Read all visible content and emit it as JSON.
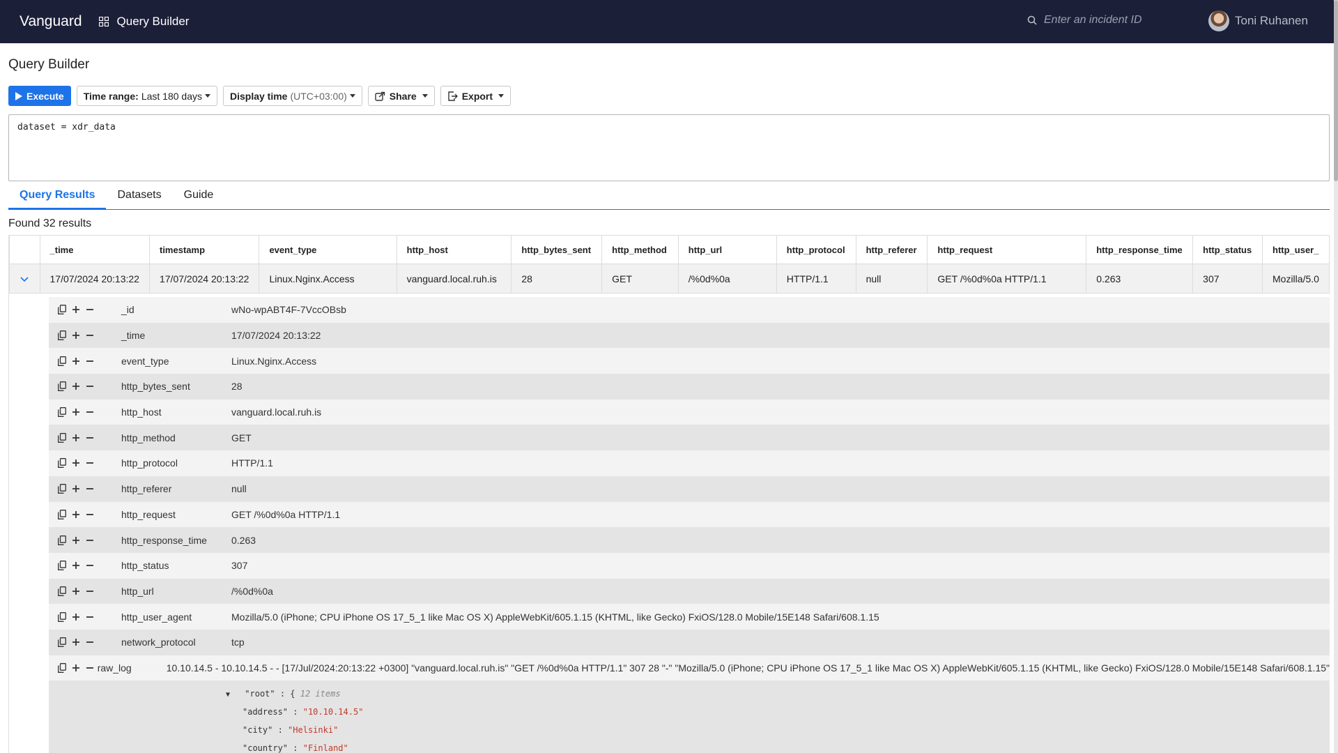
{
  "nav": {
    "brand": "Vanguard",
    "app_label": "Query Builder",
    "search_placeholder": "Enter an incident ID",
    "user_name": "Toni Ruhanen"
  },
  "page": {
    "title": "Query Builder"
  },
  "toolbar": {
    "execute_label": "Execute",
    "time_range_label": "Time range:",
    "time_range_value": "Last 180 days",
    "display_time_label": "Display time",
    "display_time_value": "(UTC+03:00)",
    "share_label": "Share",
    "export_label": "Export"
  },
  "query": {
    "text": "dataset = xdr_data"
  },
  "tabs": [
    {
      "label": "Query Results",
      "active": true
    },
    {
      "label": "Datasets",
      "active": false
    },
    {
      "label": "Guide",
      "active": false
    }
  ],
  "results": {
    "count_text": "Found 32 results",
    "columns": [
      "_time",
      "timestamp",
      "event_type",
      "http_host",
      "http_bytes_sent",
      "http_method",
      "http_url",
      "http_protocol",
      "http_referer",
      "http_request",
      "http_response_time",
      "http_status",
      "http_user_"
    ],
    "row": [
      "17/07/2024 20:13:22",
      "17/07/2024 20:13:22",
      "Linux.Nginx.Access",
      "vanguard.local.ruh.is",
      "28",
      "GET",
      "/%0d%0a",
      "HTTP/1.1",
      "null",
      "GET /%0d%0a HTTP/1.1",
      "0.263",
      "307",
      "Mozilla/5.0"
    ]
  },
  "detail": [
    {
      "name": "_id",
      "value": "wNo-wpABT4F-7VccOBsb"
    },
    {
      "name": "_time",
      "value": "17/07/2024 20:13:22"
    },
    {
      "name": "event_type",
      "value": "Linux.Nginx.Access"
    },
    {
      "name": "http_bytes_sent",
      "value": "28"
    },
    {
      "name": "http_host",
      "value": "vanguard.local.ruh.is"
    },
    {
      "name": "http_method",
      "value": "GET"
    },
    {
      "name": "http_protocol",
      "value": "HTTP/1.1"
    },
    {
      "name": "http_referer",
      "value": "null"
    },
    {
      "name": "http_request",
      "value": "GET /%0d%0a HTTP/1.1"
    },
    {
      "name": "http_response_time",
      "value": "0.263"
    },
    {
      "name": "http_status",
      "value": "307"
    },
    {
      "name": "http_url",
      "value": "/%0d%0a"
    },
    {
      "name": "http_user_agent",
      "value": "Mozilla/5.0 (iPhone; CPU iPhone OS 17_5_1 like Mac OS X) AppleWebKit/605.1.15 (KHTML, like Gecko) FxiOS/128.0 Mobile/15E148 Safari/608.1.15"
    },
    {
      "name": "network_protocol",
      "value": "tcp"
    },
    {
      "name": "raw_log",
      "value": "10.10.14.5 - 10.10.14.5 - - [17/Jul/2024:20:13:22 +0300] \"vanguard.local.ruh.is\" \"GET /%0d%0a HTTP/1.1\" 307 28 \"-\" \"Mozilla/5.0 (iPhone; CPU iPhone OS 17_5_1 like Mac OS X) AppleWebKit/605.1.15 (KHTML, like Gecko) FxiOS/128.0 Mobile/15E148 Safari/608.1.15\""
    }
  ],
  "json_view": {
    "root_key": "\"root\"",
    "root_open": ": {",
    "item_count": "12 items",
    "entries": [
      {
        "key": "\"address\"",
        "value": "\"10.10.14.5\""
      },
      {
        "key": "\"city\"",
        "value": "\"Helsinki\""
      },
      {
        "key": "\"country\"",
        "value": "\"Finland\""
      }
    ]
  },
  "icons": {
    "apps": "apps-grid-icon",
    "search": "search-icon",
    "copy": "copy-icon",
    "plus": "plus-icon",
    "minus": "minus-icon",
    "expander": "chevron-down-icon"
  },
  "colors": {
    "navbar": "#1c1f38",
    "primary": "#1e73e8",
    "json_string": "#c0392b"
  }
}
